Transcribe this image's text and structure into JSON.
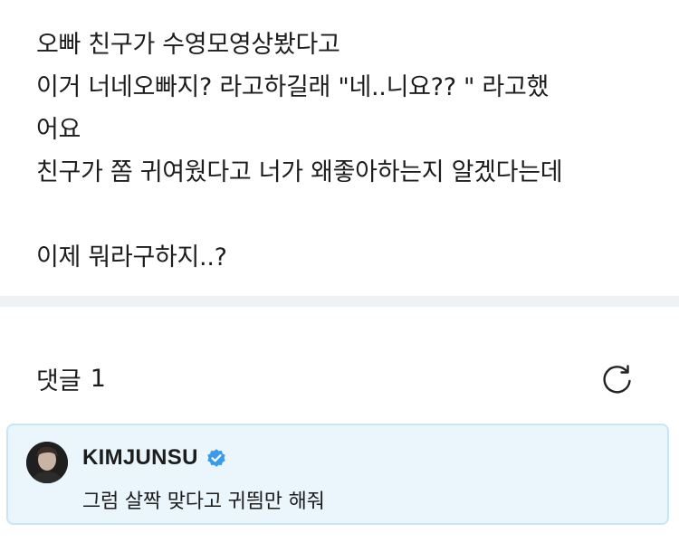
{
  "post": {
    "lines": [
      "오빠 친구가 수영모영상봤다고",
      "이거 너네오빠지? 라고하길래  \"네..니요?? \" 라고했",
      "어요",
      "친구가 쫌 귀여웠다고 너가 왜좋아하는지 알겠다는데",
      "",
      "이제 뭐라구하지..?"
    ]
  },
  "comments": {
    "header_label": "댓글",
    "count": "1",
    "refresh_icon": "refresh-icon",
    "items": [
      {
        "author": "KIMJUNSU",
        "verified": true,
        "badge_color": "#3b9bea",
        "text": "그럼 살짝 맞다고 귀띔만 해줘"
      }
    ]
  },
  "colors": {
    "divider": "#eef2f4",
    "comment_bg": "#eaf6fc",
    "comment_border": "#c6e6f5"
  }
}
